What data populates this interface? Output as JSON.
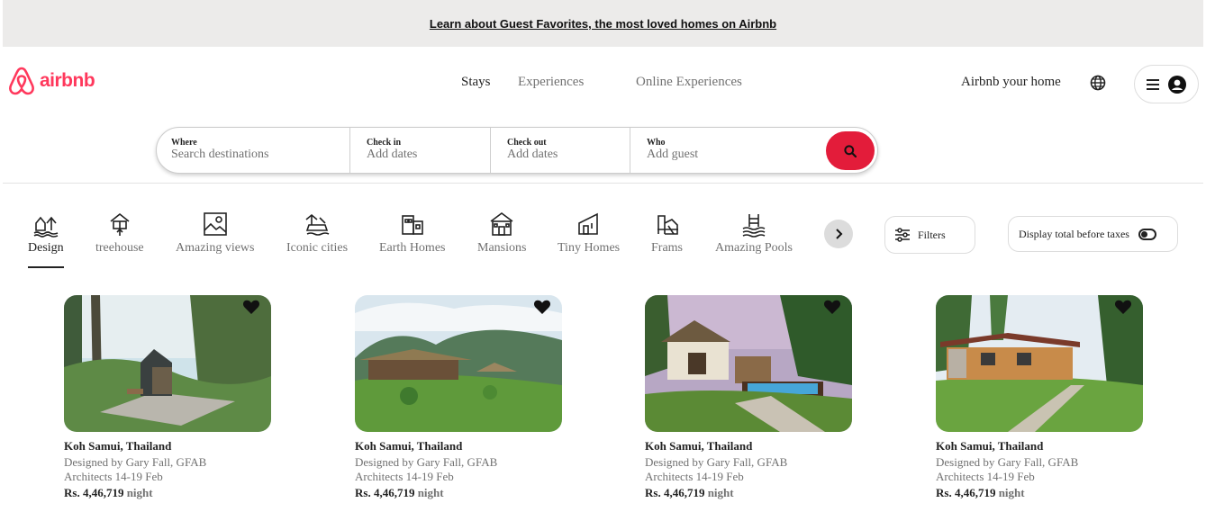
{
  "banner": {
    "link_text": "Learn about Guest Favorites, the most loved homes on Airbnb"
  },
  "header": {
    "logo_text": "airbnb",
    "nav": [
      "Stays",
      "Experiences",
      "Online Experiences"
    ],
    "host_link": "Airbnb your home",
    "icons": {
      "language": "globe-icon",
      "menu": "hamburger-icon",
      "profile": "user-avatar-icon"
    }
  },
  "search": {
    "where": {
      "label": "Where",
      "placeholder": "Search destinations"
    },
    "check_in": {
      "label": "Check in",
      "placeholder": "Add dates"
    },
    "check_out": {
      "label": "Check out",
      "placeholder": "Add dates"
    },
    "who": {
      "label": "Who",
      "placeholder": "Add guest"
    },
    "button_icon": "search-icon"
  },
  "categories": {
    "active": "Design",
    "items": [
      {
        "label": "Design",
        "icon": "design-icon"
      },
      {
        "label": "treehouse",
        "icon": "treehouse-icon"
      },
      {
        "label": "Amazing views",
        "icon": "amazing-views-icon"
      },
      {
        "label": "Iconic cities",
        "icon": "iconic-cities-icon"
      },
      {
        "label": "Earth Homes",
        "icon": "earth-homes-icon"
      },
      {
        "label": "Mansions",
        "icon": "mansions-icon"
      },
      {
        "label": "Tiny Homes",
        "icon": "tiny-homes-icon"
      },
      {
        "label": "Frams",
        "icon": "farms-icon"
      },
      {
        "label": "Amazing Pools",
        "icon": "amazing-pools-icon"
      }
    ],
    "filters_label": "Filters",
    "taxes_label": "Display total before taxes"
  },
  "listings": [
    {
      "title": "Koh Samui, Thailand",
      "desc1": "Designed by Gary Fall, GFAB",
      "desc2": "Architects 14-19 Feb",
      "price": "Rs. 4,46,719",
      "unit": "night"
    },
    {
      "title": "Koh Samui, Thailand",
      "desc1": "Designed by Gary Fall, GFAB",
      "desc2": "Architects 14-19 Feb",
      "price": "Rs. 4,46,719",
      "unit": "night"
    },
    {
      "title": "Koh Samui, Thailand",
      "desc1": "Designed by Gary Fall, GFAB",
      "desc2": "Architects 14-19 Feb",
      "price": "Rs. 4,46,719",
      "unit": "night"
    },
    {
      "title": "Koh Samui, Thailand",
      "desc1": "Designed by Gary Fall, GFAB",
      "desc2": "Architects 14-19 Feb",
      "price": "Rs. 4,46,719",
      "unit": "night"
    }
  ],
  "colors": {
    "brand": "#ff385c",
    "search_button": "#e31c3a",
    "muted_text": "#717171"
  }
}
